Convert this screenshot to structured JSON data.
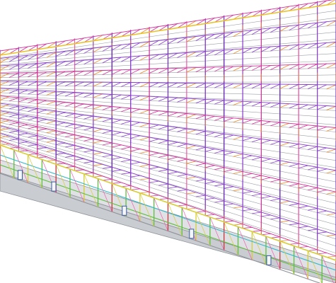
{
  "viewport": {
    "background": "#ffffff"
  },
  "model": {
    "palette": {
      "truss_purple": "#6a2bb8",
      "truss_violet": "#8a3fd0",
      "truss_magenta": "#d2339a",
      "truss_pink": "#ef5fb0",
      "truss_orange": "#f08a24",
      "truss_yellow": "#e8c52a",
      "purlin_grey": "#9aa0a6",
      "wall_yellow": "#d6cf3a",
      "wall_green": "#5fbf3f",
      "column_red": "#c8343c",
      "facade_cyan": "#35b9c9",
      "slab_grey": "#c9ccd1",
      "slab_edge": "#8f949a",
      "door_blue": "#3a5aa0"
    },
    "bays": 12,
    "frames": 18
  }
}
